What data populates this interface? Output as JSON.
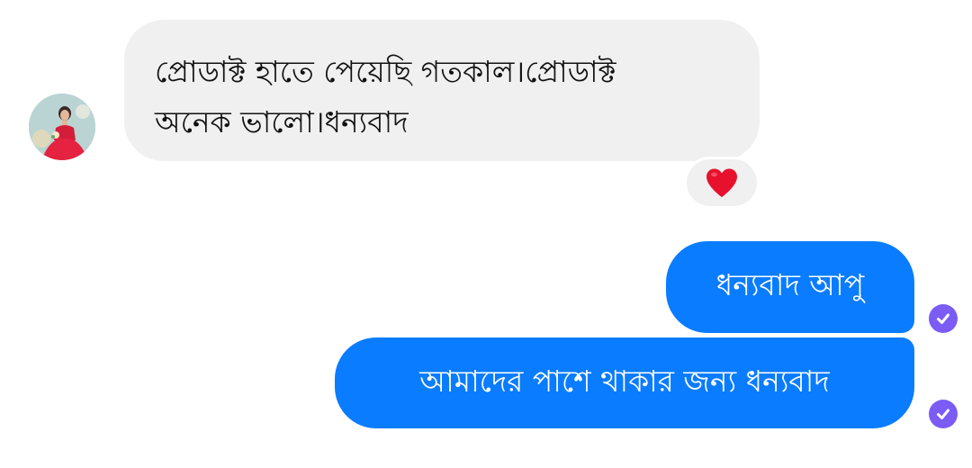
{
  "messages": [
    {
      "direction": "incoming",
      "lines": [
        "প্রোডাক্ট হাতে পেয়েছি গতকাল।প্রোডাক্ট",
        "অনেক ভালো।ধন্যবাদ"
      ],
      "reaction": "heart-emoji"
    },
    {
      "direction": "outgoing",
      "text": "ধন্যবাদ আপু",
      "status": "seen-check-icon"
    },
    {
      "direction": "outgoing",
      "text": "আমাদের পাশে থাকার জন্য ধন্যবাদ",
      "status": "seen-check-icon"
    }
  ],
  "colors": {
    "incoming_bubble": "#f0f0f0",
    "outgoing_bubble": "#0a7cff",
    "seen_indicator": "#7b5cf5",
    "reaction_heart": "#e8112d"
  }
}
